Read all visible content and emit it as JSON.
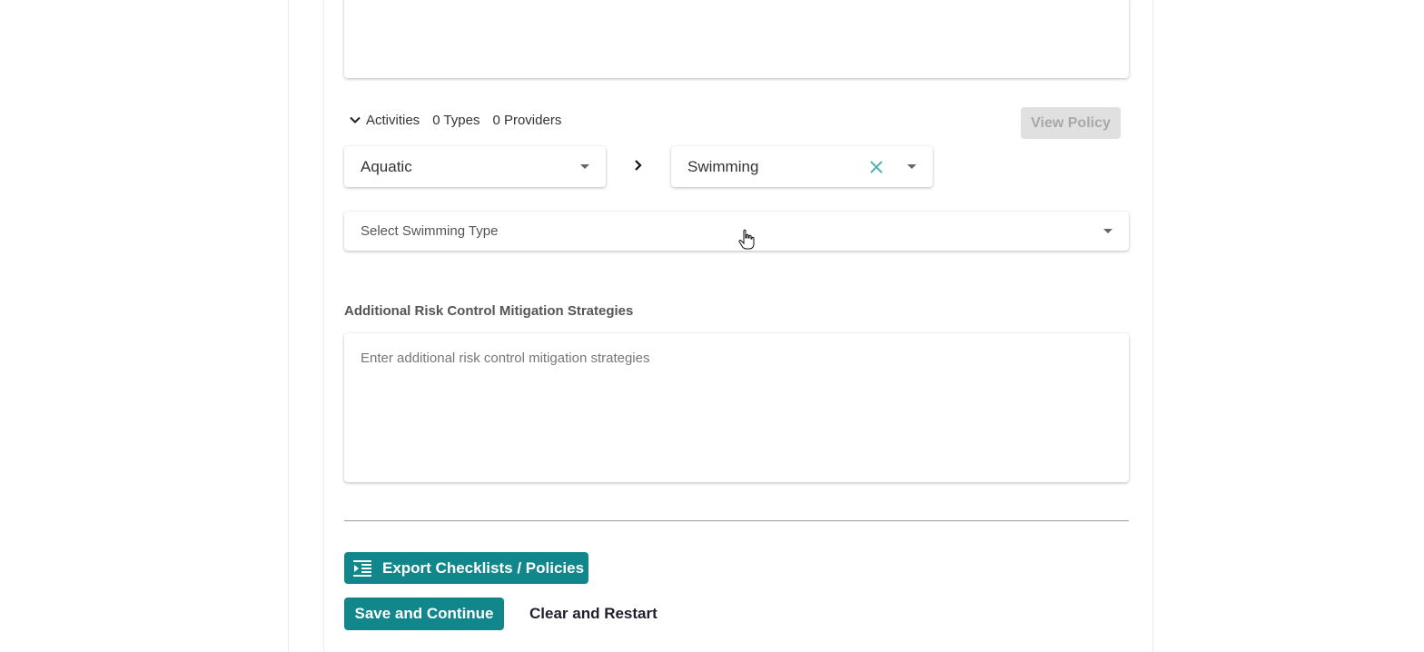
{
  "activities": {
    "label": "Activities",
    "types": "0 Types",
    "providers": "0 Providers",
    "view_policy_label": "View Policy"
  },
  "selects": {
    "category_value": "Aquatic",
    "activity_value": "Swimming",
    "type_placeholder": "Select Swimming Type"
  },
  "mitigation": {
    "label": "Additional Risk Control Mitigation Strategies",
    "placeholder": "Enter additional risk control mitigation strategies",
    "value": ""
  },
  "actions": {
    "export_label": "Export Checklists / Policies",
    "save_label": "Save and Continue",
    "clear_label": "Clear and Restart"
  },
  "colors": {
    "accent": "#11878c",
    "disabled_bg": "#e0e0e0",
    "disabled_text": "#a9a9a9",
    "clear_icon": "#4fb3b0"
  },
  "icons": {
    "activities_toggle": "chevron-down-icon",
    "breadcrumb": "chevron-right-icon",
    "clear": "close-icon",
    "dropdown": "caret-down-icon",
    "export": "list-indent-icon",
    "pointer": "hand-cursor-icon"
  }
}
